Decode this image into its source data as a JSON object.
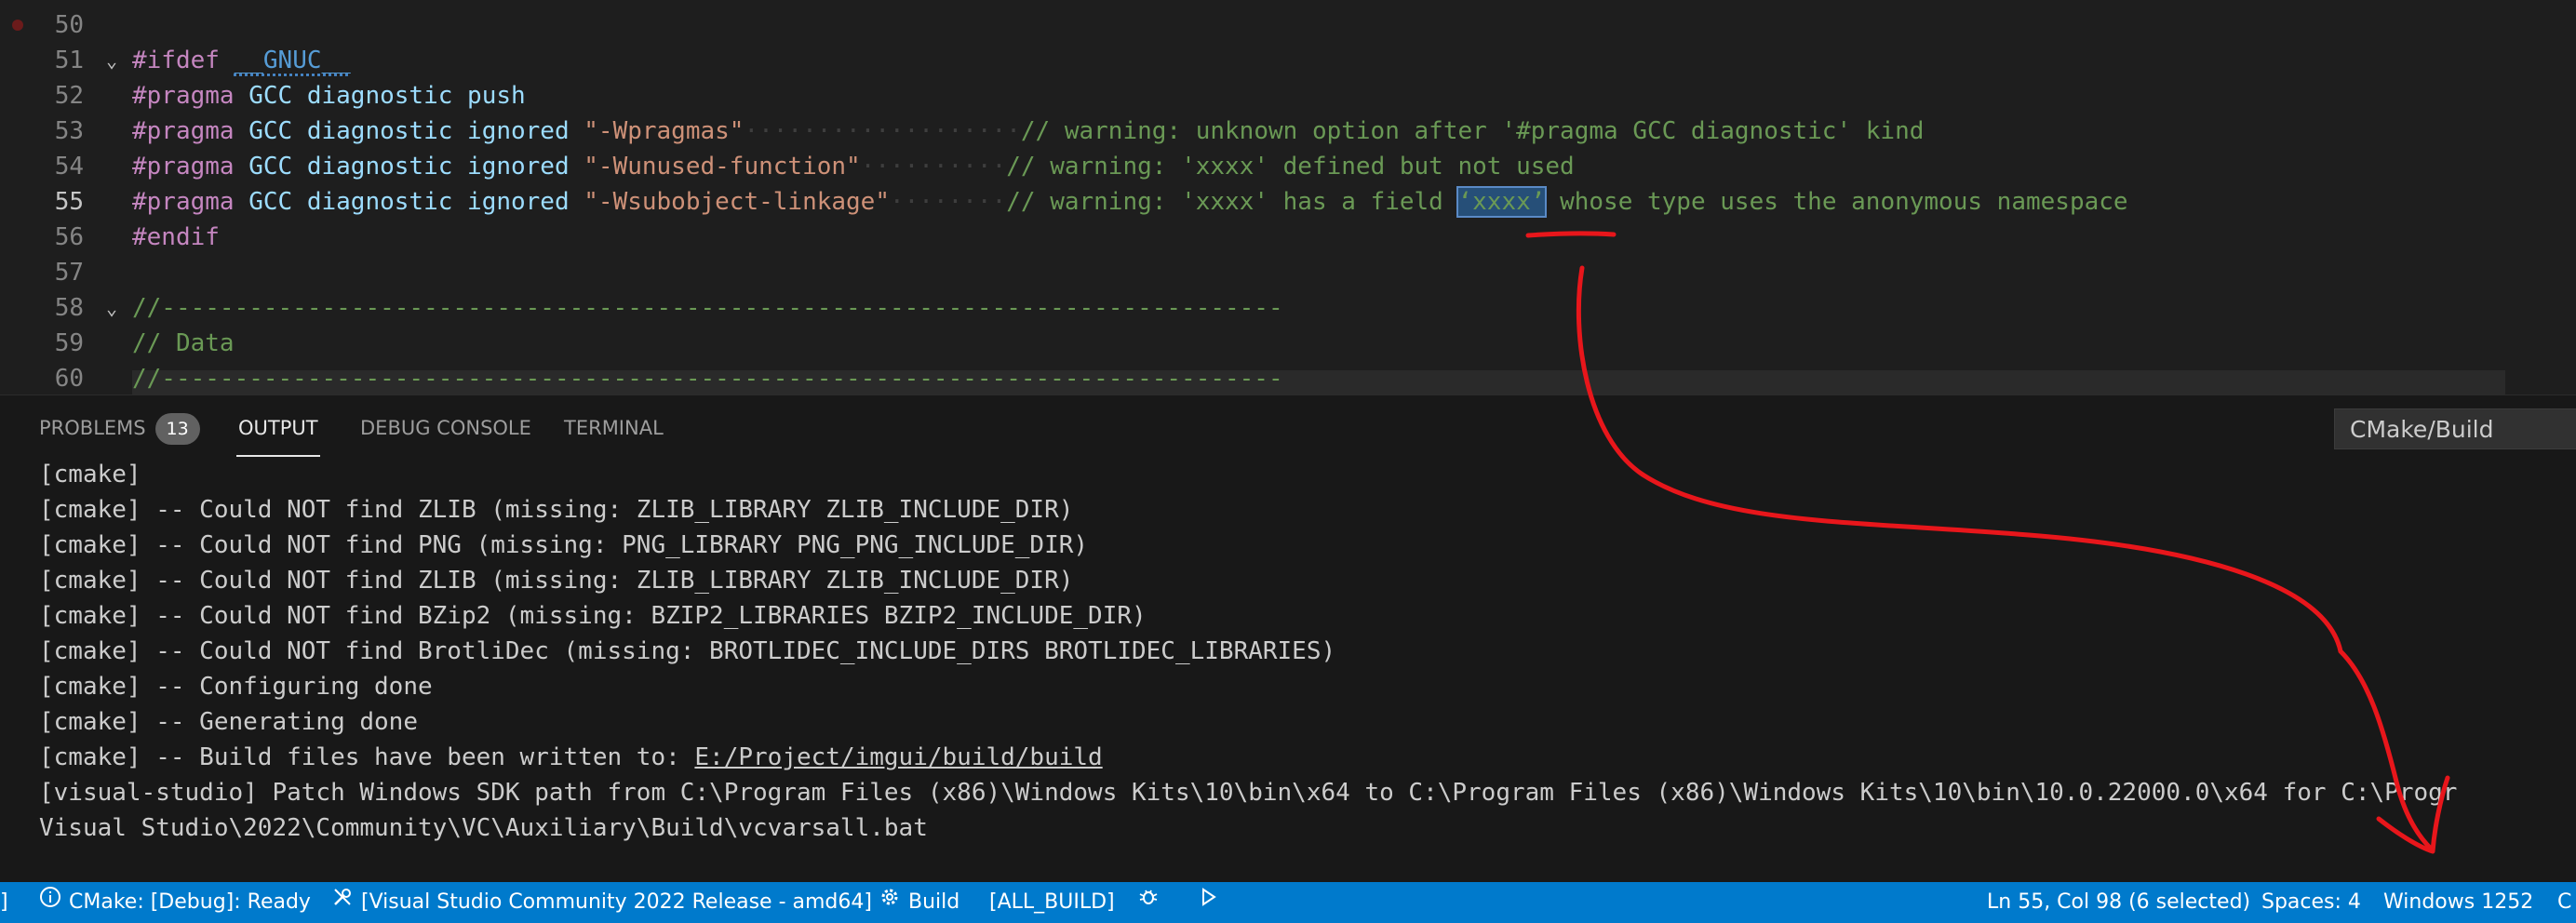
{
  "editor": {
    "lines": [
      {
        "n": "50",
        "segs": []
      },
      {
        "n": "51",
        "fold": "⌄",
        "segs": [
          {
            "c": "k-dir",
            "t": "#ifdef"
          },
          {
            "c": "",
            "t": " "
          },
          {
            "c": "k-mac",
            "t": "__GNUC__"
          }
        ]
      },
      {
        "n": "52",
        "segs": [
          {
            "c": "k-dir",
            "t": "#pragma"
          },
          {
            "c": "",
            "t": " "
          },
          {
            "c": "k-id",
            "t": "GCC diagnostic push"
          }
        ]
      },
      {
        "n": "53",
        "segs": [
          {
            "c": "k-dir",
            "t": "#pragma"
          },
          {
            "c": "",
            "t": " "
          },
          {
            "c": "k-id",
            "t": "GCC diagnostic ignored"
          },
          {
            "c": "",
            "t": " "
          },
          {
            "c": "k-str",
            "t": "\"-Wpragmas\""
          },
          {
            "c": "dots",
            "t": "···················"
          },
          {
            "c": "k-com",
            "t": "// warning: unknown option after '#pragma GCC diagnostic' kind"
          }
        ]
      },
      {
        "n": "54",
        "segs": [
          {
            "c": "k-dir",
            "t": "#pragma"
          },
          {
            "c": "",
            "t": " "
          },
          {
            "c": "k-id",
            "t": "GCC diagnostic ignored"
          },
          {
            "c": "",
            "t": " "
          },
          {
            "c": "k-str",
            "t": "\"-Wunused-function\""
          },
          {
            "c": "dots",
            "t": "··········"
          },
          {
            "c": "k-com",
            "t": "// warning: 'xxxx' defined but not used"
          }
        ]
      },
      {
        "n": "55",
        "active": true,
        "segs": [
          {
            "c": "k-dir",
            "t": "#pragma"
          },
          {
            "c": "",
            "t": " "
          },
          {
            "c": "k-id",
            "t": "GCC diagnostic ignored"
          },
          {
            "c": "",
            "t": " "
          },
          {
            "c": "k-str",
            "t": "\"-Wsubobject-linkage\""
          },
          {
            "c": "dots",
            "t": "········"
          },
          {
            "c": "k-com",
            "t": "// warning: 'xxxx' has a field "
          },
          {
            "c": "k-sel",
            "t": "‘xxxx’"
          },
          {
            "c": "k-com",
            "t": " whose type uses the anonymous namespace"
          }
        ]
      },
      {
        "n": "56",
        "segs": [
          {
            "c": "k-dir",
            "t": "#endif"
          }
        ]
      },
      {
        "n": "57",
        "segs": []
      },
      {
        "n": "58",
        "fold": "⌄",
        "segs": [
          {
            "c": "k-com",
            "t": "//-----------------------------------------------------------------------------"
          }
        ]
      },
      {
        "n": "59",
        "segs": [
          {
            "c": "k-com",
            "t": "// Data"
          }
        ]
      },
      {
        "n": "60",
        "segs": [
          {
            "c": "k-com",
            "t": "//-----------------------------------------------------------------------------"
          }
        ]
      }
    ]
  },
  "panel": {
    "tabs": {
      "problems": "PROBLEMS",
      "problems_count": "13",
      "output": "OUTPUT",
      "debug_console": "DEBUG CONSOLE",
      "terminal": "TERMINAL"
    },
    "channel": "CMake/Build",
    "lines": [
      "[cmake]",
      "[cmake] -- Could NOT find ZLIB (missing: ZLIB_LIBRARY ZLIB_INCLUDE_DIR)",
      "[cmake] -- Could NOT find PNG (missing: PNG_LIBRARY PNG_PNG_INCLUDE_DIR)",
      "[cmake] -- Could NOT find ZLIB (missing: ZLIB_LIBRARY ZLIB_INCLUDE_DIR)",
      "[cmake] -- Could NOT find BZip2 (missing: BZIP2_LIBRARIES BZIP2_INCLUDE_DIR)",
      "[cmake] -- Could NOT find BrotliDec (missing: BROTLIDEC_INCLUDE_DIRS BROTLIDEC_LIBRARIES)",
      "[cmake] -- Configuring done",
      "[cmake] -- Generating done"
    ],
    "build_prefix": "[cmake] -- Build files have been written to: ",
    "build_link": "E:/Project/imgui/build/build",
    "patch_line": "[visual-studio] Patch Windows SDK path from C:\\Program Files (x86)\\Windows Kits\\10\\bin\\x64 to C:\\Program Files (x86)\\Windows Kits\\10\\bin\\10.0.22000.0\\x64 for C:\\Progr",
    "patch_line2": "Visual Studio\\2022\\Community\\VC\\Auxiliary\\Build\\vcvarsall.bat"
  },
  "statusbar": {
    "edge_left": "]",
    "cmake_status": "CMake: [Debug]: Ready",
    "kit": "[Visual Studio Community 2022 Release - amd64]",
    "build": "Build",
    "target": "[ALL_BUILD]",
    "position": "Ln 55, Col 98 (6 selected)",
    "spaces": "Spaces: 4",
    "encoding": "Windows 1252",
    "edge_right": "C"
  },
  "colors": {
    "statusbar_bg": "#007acc",
    "annotation": "#e8161b",
    "selection": "#264f78"
  },
  "icons": [
    "info-icon",
    "tools-icon",
    "gear-icon",
    "bug-icon",
    "play-icon",
    "chevron-down-icon"
  ]
}
